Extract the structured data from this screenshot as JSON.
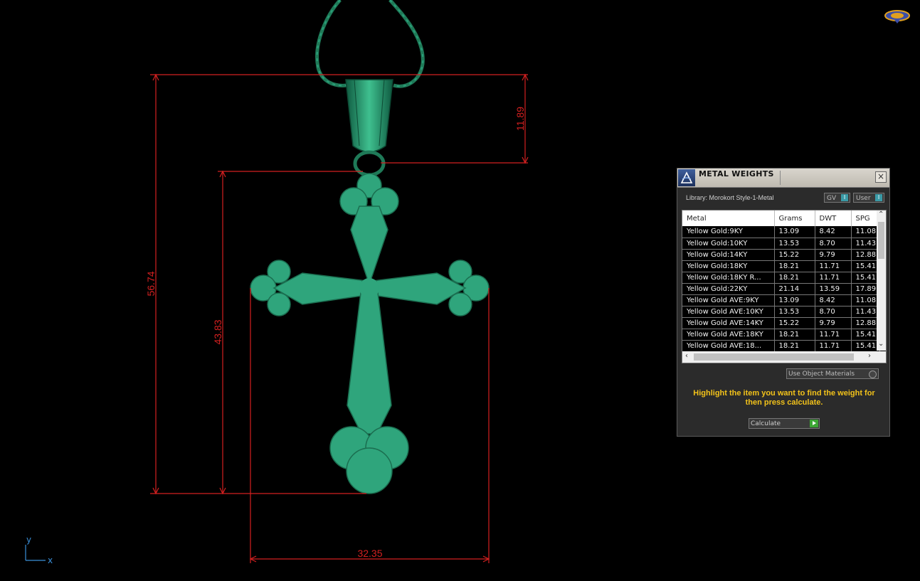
{
  "dimensions": {
    "total_height": "56.74",
    "cross_height": "43.83",
    "bail_height": "11.89",
    "width": "32.35"
  },
  "axis": {
    "y_label": "y",
    "x_label": "x"
  },
  "colors": {
    "dimension": "#d42020",
    "model": "#2fa57c",
    "panel_highlight": "#f2c21a"
  },
  "panel": {
    "title": "METAL WEIGHTS",
    "close_icon": "close-icon",
    "library": "Library: Morokort Style-1-Metal",
    "toggle_gv": "GV",
    "toggle_user": "User",
    "columns": [
      "Metal",
      "Grams",
      "DWT",
      "SPG"
    ],
    "rows": [
      [
        "Yellow Gold:9KY",
        "13.09",
        "8.42",
        "11.08"
      ],
      [
        "Yellow Gold:10KY",
        "13.53",
        "8.70",
        "11.43"
      ],
      [
        "Yellow Gold:14KY",
        "15.22",
        "9.79",
        "12.88"
      ],
      [
        "Yellow Gold:18KY",
        "18.21",
        "11.71",
        "15.41"
      ],
      [
        "Yellow Gold:18KY R...",
        "18.21",
        "11.71",
        "15.41"
      ],
      [
        "Yellow Gold:22KY",
        "21.14",
        "13.59",
        "17.89"
      ],
      [
        "Yellow Gold AVE:9KY",
        "13.09",
        "8.42",
        "11.08"
      ],
      [
        "Yellow Gold AVE:10KY",
        "13.53",
        "8.70",
        "11.43"
      ],
      [
        "Yellow Gold AVE:14KY",
        "15.22",
        "9.79",
        "12.88"
      ],
      [
        "Yellow Gold AVE:18KY",
        "18.21",
        "11.71",
        "15.41"
      ],
      [
        "Yellow Gold AVE:18...",
        "18.21",
        "11.71",
        "15.41"
      ]
    ],
    "use_object_materials": "Use Object Materials",
    "hint": "Highlight the item you want to find the weight for then press calculate.",
    "calculate": "Calculate"
  }
}
